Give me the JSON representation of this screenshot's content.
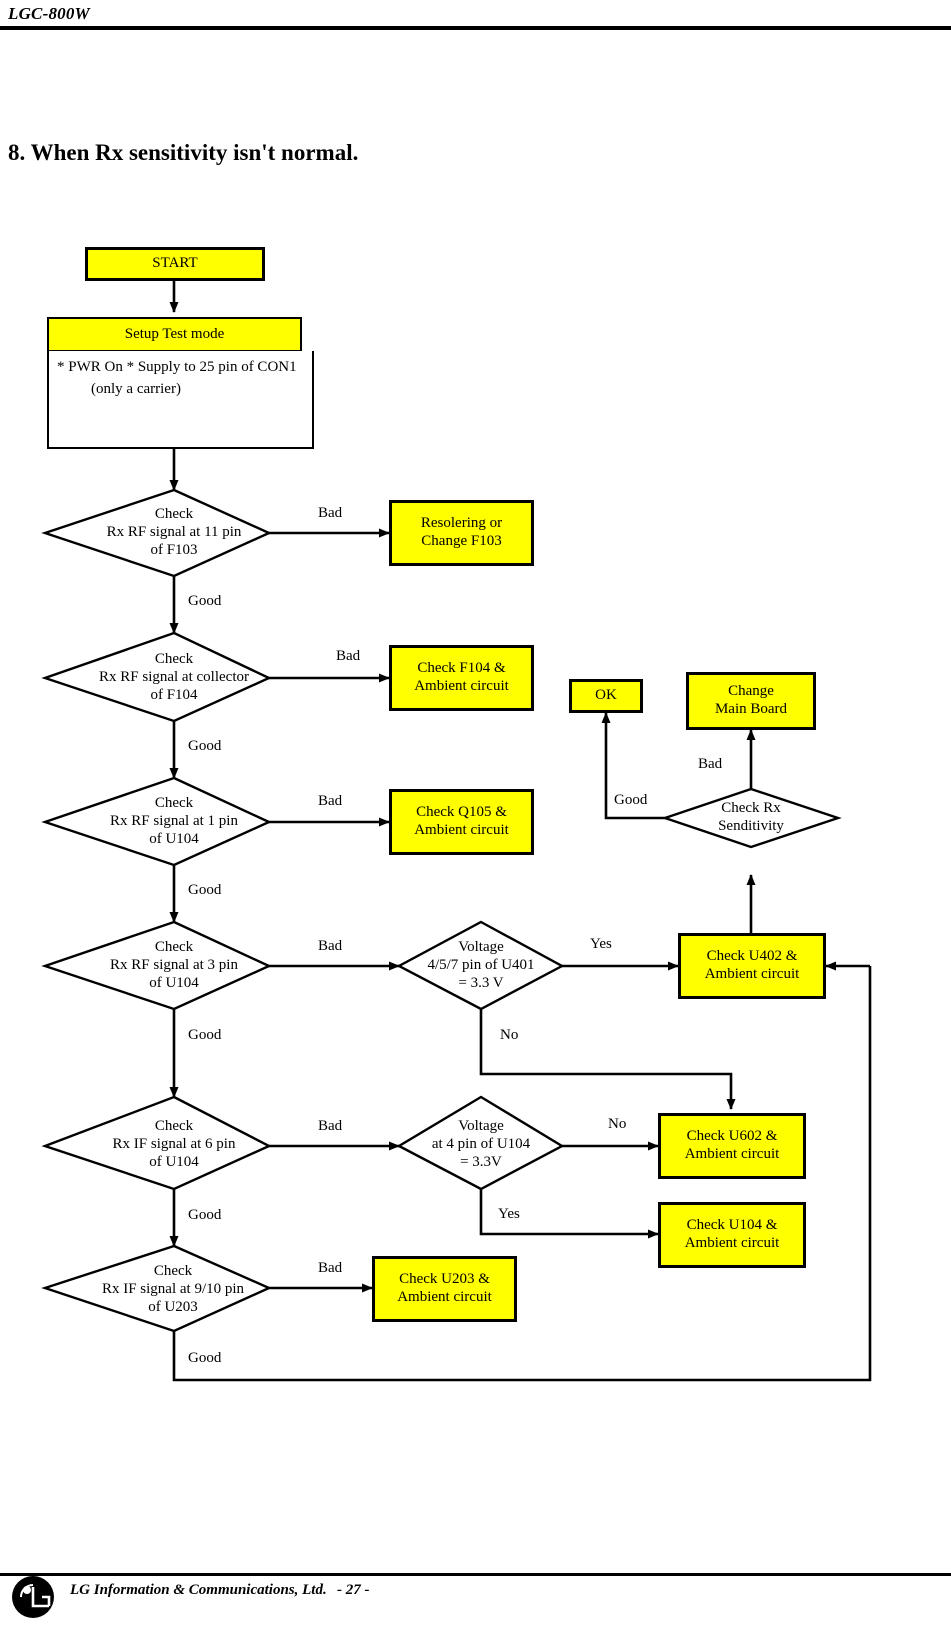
{
  "header": {
    "model": "LGC-800W"
  },
  "section": {
    "title": "8. When Rx sensitivity isn't normal."
  },
  "footer": {
    "company": "LG Information & Communications, Ltd.",
    "page": "- 27 -",
    "logo_name": "lg-logo"
  },
  "flowchart": {
    "start": {
      "label": "START"
    },
    "setup": {
      "header": "Setup Test mode",
      "line1": "* PWR On",
      "line2": "* Supply to 25 pin of CON1",
      "line3": "(only a carrier)"
    },
    "decisions": [
      {
        "id": "d1",
        "l1": "Check",
        "l2": "Rx RF signal at 11 pin",
        "l3": "of F103"
      },
      {
        "id": "d2",
        "l1": "Check",
        "l2": "Rx RF signal at collector",
        "l3": "of F104"
      },
      {
        "id": "d3",
        "l1": "Check",
        "l2": "Rx RF signal at 1 pin",
        "l3": "of U104"
      },
      {
        "id": "d4",
        "l1": "Check",
        "l2": "Rx RF signal at 3 pin",
        "l3": "of U104"
      },
      {
        "id": "d5",
        "l1": "Check",
        "l2": "Rx IF signal at 6 pin",
        "l3": "of U104"
      },
      {
        "id": "d6",
        "l1": "Check",
        "l2": "Rx IF signal at 9/10 pin",
        "l3": "of U203"
      },
      {
        "id": "v1",
        "l1": "Voltage",
        "l2": "4/5/7 pin of U401",
        "l3": "= 3.3 V"
      },
      {
        "id": "v2",
        "l1": "Voltage",
        "l2": "at 4 pin of U104",
        "l3": "= 3.3V"
      },
      {
        "id": "rx",
        "l1": "Check Rx",
        "l2": "Senditivity",
        "l3": ""
      }
    ],
    "actions": [
      {
        "id": "a1",
        "l1": "Resolering or",
        "l2": "Change F103"
      },
      {
        "id": "a2",
        "l1": "Check F104 &",
        "l2": "Ambient circuit"
      },
      {
        "id": "a3",
        "l1": "Check Q105 &",
        "l2": "Ambient circuit"
      },
      {
        "id": "a4",
        "l1": "Check U402 &",
        "l2": "Ambient circuit"
      },
      {
        "id": "a5",
        "l1": "Check U602 &",
        "l2": "Ambient circuit"
      },
      {
        "id": "a6",
        "l1": "Check U104 &",
        "l2": "Ambient circuit"
      },
      {
        "id": "a7",
        "l1": "Check U203 &",
        "l2": "Ambient circuit"
      },
      {
        "id": "ok",
        "l1": "OK",
        "l2": ""
      },
      {
        "id": "mb",
        "l1": "Change",
        "l2": "Main Board"
      }
    ],
    "edge_labels": {
      "bad1": "Bad",
      "good1": "Good",
      "bad2": "Bad",
      "good2": "Good",
      "bad3": "Bad",
      "good3": "Good",
      "bad4": "Bad",
      "good4": "Good",
      "bad5": "Bad",
      "good5": "Good",
      "bad6": "Bad",
      "good6": "Good",
      "yes1": "Yes",
      "no1": "No",
      "no2": "No",
      "yes2": "Yes",
      "good_rx": "Good",
      "bad_rx": "Bad"
    },
    "colors": {
      "fill": "#FFFF00",
      "stroke": "#000000",
      "paper": "#FFFFFF"
    }
  }
}
